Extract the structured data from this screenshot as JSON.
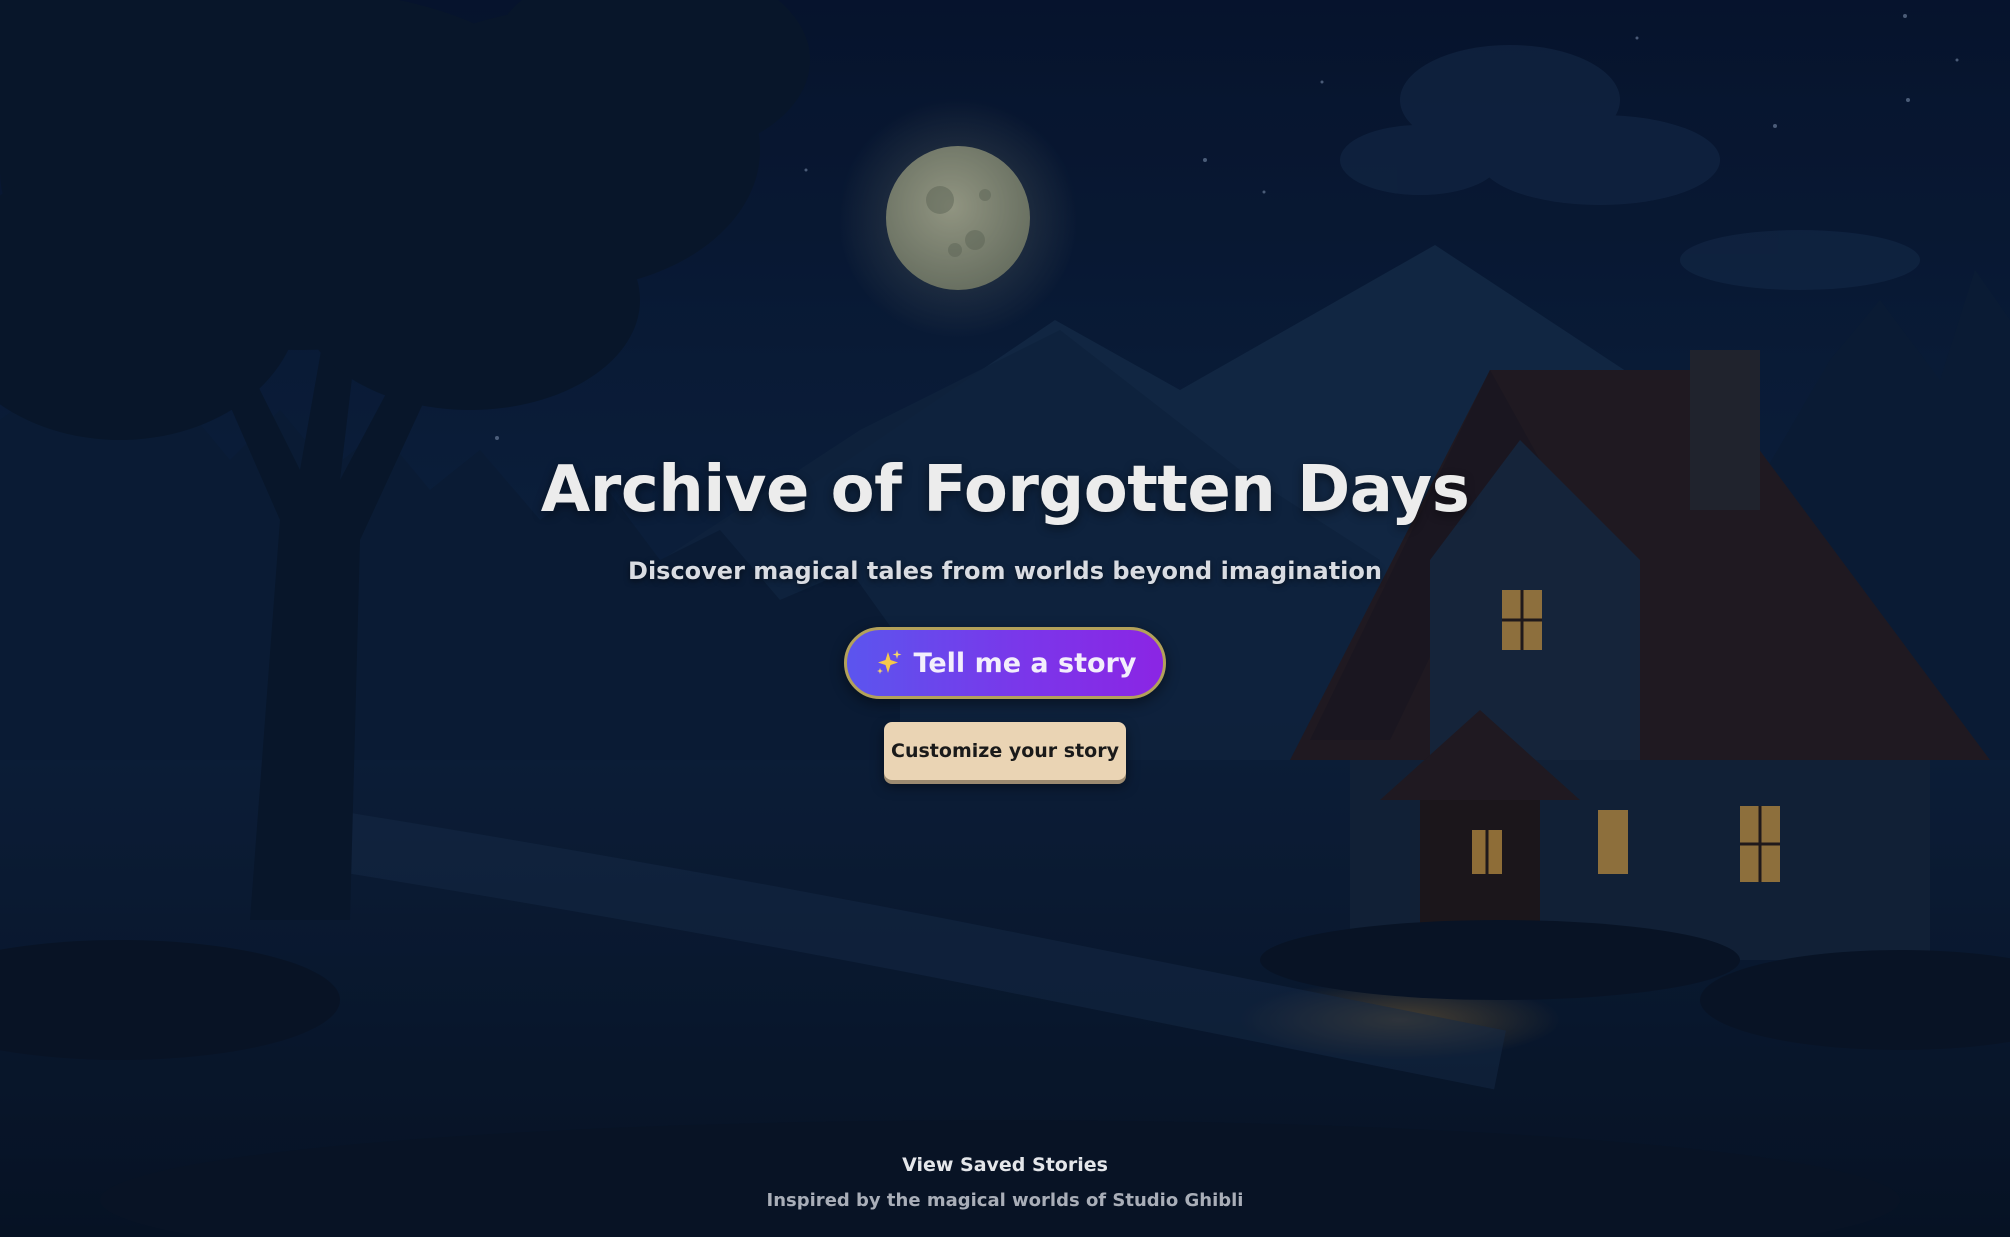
{
  "hero": {
    "title": "Archive of Forgotten Days",
    "subtitle": "Discover magical tales from worlds beyond imagination"
  },
  "actions": {
    "primary_label": "Tell me a story",
    "primary_icon": "sparkles-icon",
    "secondary_label": "Customize your story"
  },
  "footer": {
    "saved_link": "View Saved Stories",
    "credit": "Inspired by the magical worlds of Studio Ghibli"
  },
  "colors": {
    "sky": "#0b1a33",
    "primary_gradient_start": "#5b55ee",
    "primary_gradient_end": "#8b25e4",
    "primary_border": "#b3a15a",
    "secondary_bg": "#ead4b4",
    "window_glow": "#e0a849"
  }
}
